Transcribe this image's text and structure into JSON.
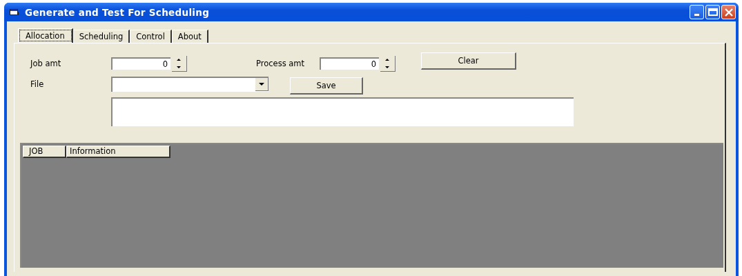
{
  "window": {
    "title": "Generate and Test For Scheduling"
  },
  "tabs": [
    {
      "label": "Allocation",
      "selected": true
    },
    {
      "label": "Scheduling",
      "selected": false
    },
    {
      "label": "Control",
      "selected": false
    },
    {
      "label": "About",
      "selected": false
    }
  ],
  "form": {
    "job_amt": {
      "label": "Job amt",
      "value": "0"
    },
    "process_amt": {
      "label": "Process amt",
      "value": "0"
    },
    "clear_button": "Clear",
    "file": {
      "label": "File"
    },
    "save_button": "Save"
  },
  "grid": {
    "columns": [
      "JOB",
      "Information"
    ]
  }
}
